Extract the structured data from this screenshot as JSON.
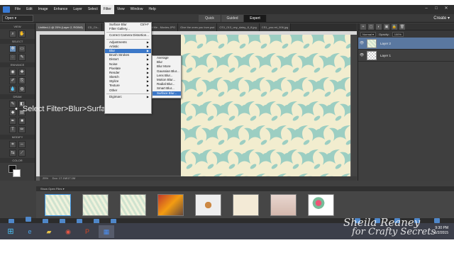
{
  "menubar": {
    "items": [
      {
        "label": "File"
      },
      {
        "label": "Edit"
      },
      {
        "label": "Image"
      },
      {
        "label": "Enhance"
      },
      {
        "label": "Layer"
      },
      {
        "label": "Select"
      },
      {
        "label": "Filter",
        "active": true
      },
      {
        "label": "View"
      },
      {
        "label": "Window"
      },
      {
        "label": "Help"
      }
    ]
  },
  "modebar": {
    "open_label": "Open",
    "modes": [
      {
        "label": "Quick"
      },
      {
        "label": "Guided"
      },
      {
        "label": "Expert",
        "active": true
      }
    ],
    "create_label": "Create"
  },
  "toolbox": {
    "sections": [
      "VIEW",
      "SELECT",
      "ENHANCE",
      "DRAW",
      "MODIFY",
      "COLOR"
    ]
  },
  "doc_tabs": [
    {
      "label": "Untitled-1 @ 25% (Layer 2, RGB/8)",
      "active": true
    },
    {
      "label": "CD_Ch..."
    },
    {
      "label": "...emetle_domask_9.jpg"
    },
    {
      "label": "Jeena and Me - Movies.JPG"
    },
    {
      "label": "Give the ones you love.psd"
    },
    {
      "label": "CS1_013_ony_daisy_8_8.jpg"
    },
    {
      "label": "CS1_you.ret_006.jpg"
    }
  ],
  "filter_menu": {
    "items": [
      {
        "label": "Surface Blur",
        "shortcut": "Ctrl+F"
      },
      {
        "label": "Filter Gallery..."
      },
      {
        "sep": true
      },
      {
        "label": "Correct Camera Distortion..."
      },
      {
        "sep": true
      },
      {
        "label": "Adjustments",
        "sub": true
      },
      {
        "label": "Artistic",
        "sub": true
      },
      {
        "label": "Blur",
        "sub": true,
        "highlight": true
      },
      {
        "label": "Brush Strokes",
        "sub": true
      },
      {
        "label": "Distort",
        "sub": true
      },
      {
        "label": "Noise",
        "sub": true
      },
      {
        "label": "Pixelate",
        "sub": true
      },
      {
        "label": "Render",
        "sub": true
      },
      {
        "label": "Sketch",
        "sub": true
      },
      {
        "label": "Stylize",
        "sub": true
      },
      {
        "label": "Texture",
        "sub": true
      },
      {
        "label": "Other",
        "sub": true
      },
      {
        "sep": true
      },
      {
        "label": "Digimarc",
        "sub": true
      }
    ]
  },
  "blur_menu": {
    "items": [
      {
        "label": "Average"
      },
      {
        "label": "Blur"
      },
      {
        "label": "Blur More"
      },
      {
        "label": "Gaussian Blur..."
      },
      {
        "label": "Lens Blur..."
      },
      {
        "label": "Motion Blur..."
      },
      {
        "label": "Radial Blur..."
      },
      {
        "label": "Smart Blur..."
      },
      {
        "label": "Surface Blur...",
        "highlight": true
      }
    ]
  },
  "instruction": {
    "bullet": "•",
    "text": "Select Filter>Blur>Surface Blur"
  },
  "canvas_status": {
    "zoom": "25%",
    "doc": "Doc: 17.1M/17.1M"
  },
  "layers_panel": {
    "mode": "Normal",
    "opacity_label": "Opacity:",
    "opacity": "100%",
    "layers": [
      {
        "name": "Layer 2",
        "selected": true
      },
      {
        "name": "Layer 1"
      }
    ]
  },
  "photo_bin": {
    "label": "Show Open Files",
    "thumbs": 8
  },
  "appbar": {
    "left": [
      {
        "label": "Photo Bin"
      },
      {
        "label": "Tool Options"
      },
      {
        "label": "Undo"
      },
      {
        "label": "Redo"
      },
      {
        "label": "Rotate"
      },
      {
        "label": "Layout"
      },
      {
        "label": "Organizer"
      }
    ],
    "right": [
      {
        "label": "Layers"
      },
      {
        "label": "Effects"
      },
      {
        "label": "Graphics"
      },
      {
        "label": "Favorites"
      },
      {
        "label": "More"
      }
    ]
  },
  "taskbar": {
    "time": "9:30 PM",
    "date": "6/2/2015"
  },
  "watermark": {
    "line1": "Sheila Reaney",
    "line2": "for Crafty Secrets"
  },
  "colors": {
    "menu_highlight": "#3c78c8",
    "pattern_bg": "#f2edcf",
    "pattern_fg": "#8ec9c0"
  }
}
